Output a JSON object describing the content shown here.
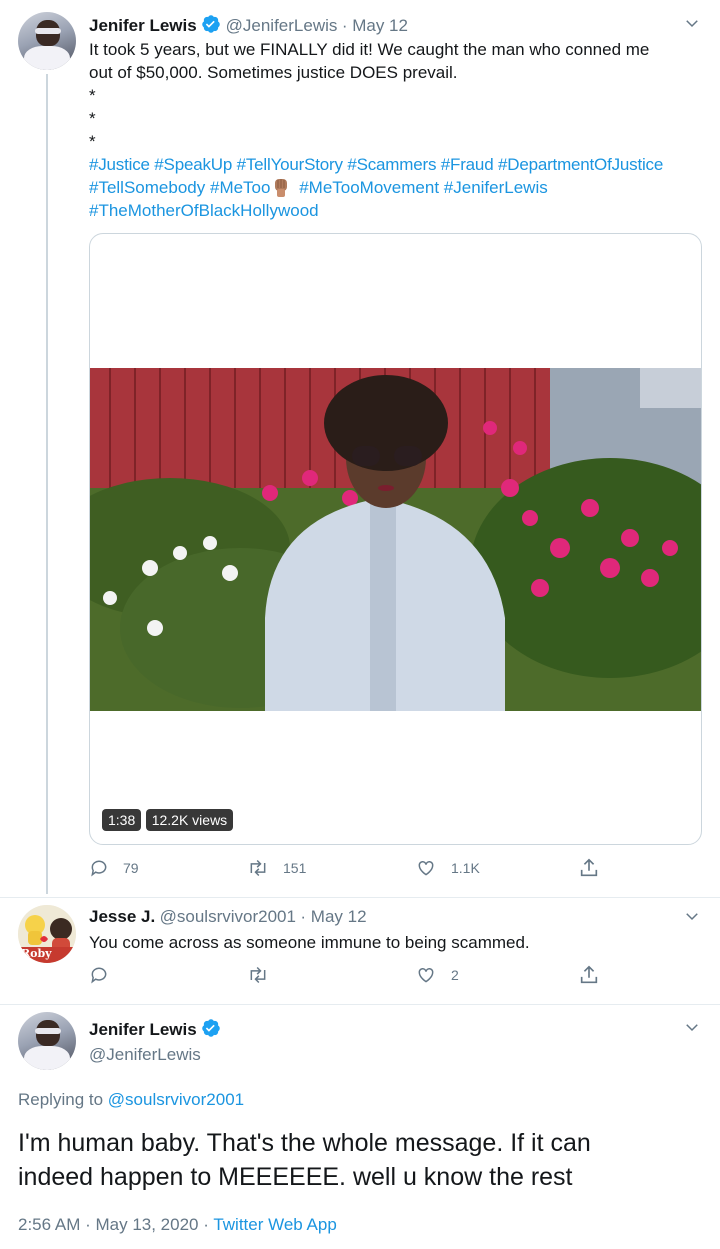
{
  "tweet1": {
    "name": "Jenifer Lewis",
    "handle": "@JeniferLewis",
    "date": "· May 12",
    "line1": "It took 5 years, but we FINALLY did it! We caught the man who conned me",
    "line2": "out of $50,000. Sometimes justice DOES prevail.",
    "asterisk": "*",
    "hashtags_line1": [
      "#Justice",
      "#SpeakUp",
      "#TellYourStory",
      "#Scammers",
      "#Fraud",
      "#DepartmentOfJustice"
    ],
    "hashtags_line2a": [
      "#TellSomebody",
      "#MeToo"
    ],
    "hashtags_line2b": [
      "#MeTooMovement",
      "#JeniferLewis"
    ],
    "hashtags_line3": [
      "#TheMotherOfBlackHollywood"
    ],
    "video": {
      "duration": "1:38",
      "views": "12.2K views"
    },
    "replies": "79",
    "retweets": "151",
    "likes": "1.1K"
  },
  "tweet2": {
    "name": "Jesse J.",
    "handle": "@soulsrvivor2001",
    "date": "· May 12",
    "text": "You come across as someone immune to being scammed.",
    "likes": "2",
    "avatar_text": "Roby"
  },
  "tweet3": {
    "name": "Jenifer Lewis",
    "handle": "@JeniferLewis",
    "replying_prefix": "Replying to",
    "replying_handle": "@soulsrvivor2001",
    "line1": "I'm human baby. That's the whole message. If it can",
    "line2": "indeed happen to MEEEEEE. well u know the rest",
    "timestamp": "2:56 AM · May 13, 2020 ·",
    "source": "Twitter Web App"
  },
  "colors": {
    "link": "#1b95e0",
    "muted": "#657786",
    "verified": "#1da1f2"
  }
}
